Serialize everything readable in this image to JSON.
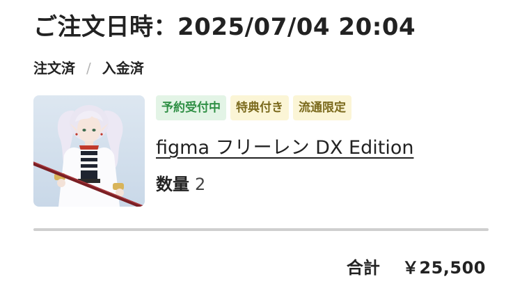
{
  "order": {
    "date_label": "ご注文日時",
    "date_separator": "：",
    "datetime": "2025/07/04 20:04"
  },
  "status": {
    "ordered": "注文済",
    "separator": "/",
    "paid": "入金済"
  },
  "product": {
    "image_icon": "figure-thumbnail",
    "tags": [
      "予約受付中",
      "特典付き",
      "流通限定"
    ],
    "name": "figma フリーレン DX Edition",
    "quantity_label": "数量",
    "quantity": "2"
  },
  "summary": {
    "total_label": "合計",
    "total_value": "￥25,500"
  },
  "colors": {
    "tag_green_bg": "#e3f4e6",
    "tag_green_text": "#2f8f45",
    "tag_yellow_bg": "#fbf5d6",
    "tag_yellow_text": "#7b6a1d",
    "divider": "#cfcfcf"
  }
}
